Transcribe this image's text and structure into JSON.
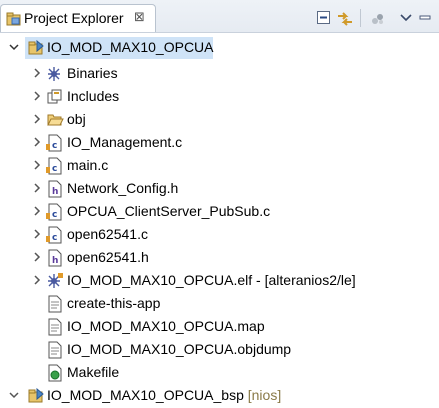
{
  "tab": {
    "title": "Project Explorer",
    "close_symbol": "⊠"
  },
  "tree": {
    "root": {
      "label": "IO_MOD_MAX10_OPCUA",
      "expanded": true,
      "selected": true
    },
    "children": [
      {
        "label": "Binaries",
        "icon": "binaries-icon",
        "expandable": true
      },
      {
        "label": "Includes",
        "icon": "includes-icon",
        "expandable": true
      },
      {
        "label": "obj",
        "icon": "folder-icon",
        "expandable": true
      },
      {
        "label": "IO_Management.c",
        "icon": "c-file-icon",
        "expandable": true
      },
      {
        "label": "main.c",
        "icon": "c-file-icon",
        "expandable": true
      },
      {
        "label": "Network_Config.h",
        "icon": "h-file-icon",
        "expandable": true
      },
      {
        "label": "OPCUA_ClientServer_PubSub.c",
        "icon": "c-file-icon",
        "expandable": true
      },
      {
        "label": "open62541.c",
        "icon": "c-file-icon",
        "expandable": true
      },
      {
        "label": "open62541.h",
        "icon": "h-file-icon",
        "expandable": true
      },
      {
        "label": "IO_MOD_MAX10_OPCUA.elf - [alteranios2/le]",
        "icon": "elf-binary-icon",
        "expandable": true
      },
      {
        "label": "create-this-app",
        "icon": "text-file-icon",
        "expandable": false
      },
      {
        "label": "IO_MOD_MAX10_OPCUA.map",
        "icon": "text-file-icon",
        "expandable": false
      },
      {
        "label": "IO_MOD_MAX10_OPCUA.objdump",
        "icon": "text-file-icon",
        "expandable": false
      },
      {
        "label": "Makefile",
        "icon": "makefile-icon",
        "expandable": false
      }
    ],
    "bsp": {
      "label": "IO_MOD_MAX10_OPCUA_bsp",
      "decoration": "[nios]",
      "expanded": false
    }
  }
}
